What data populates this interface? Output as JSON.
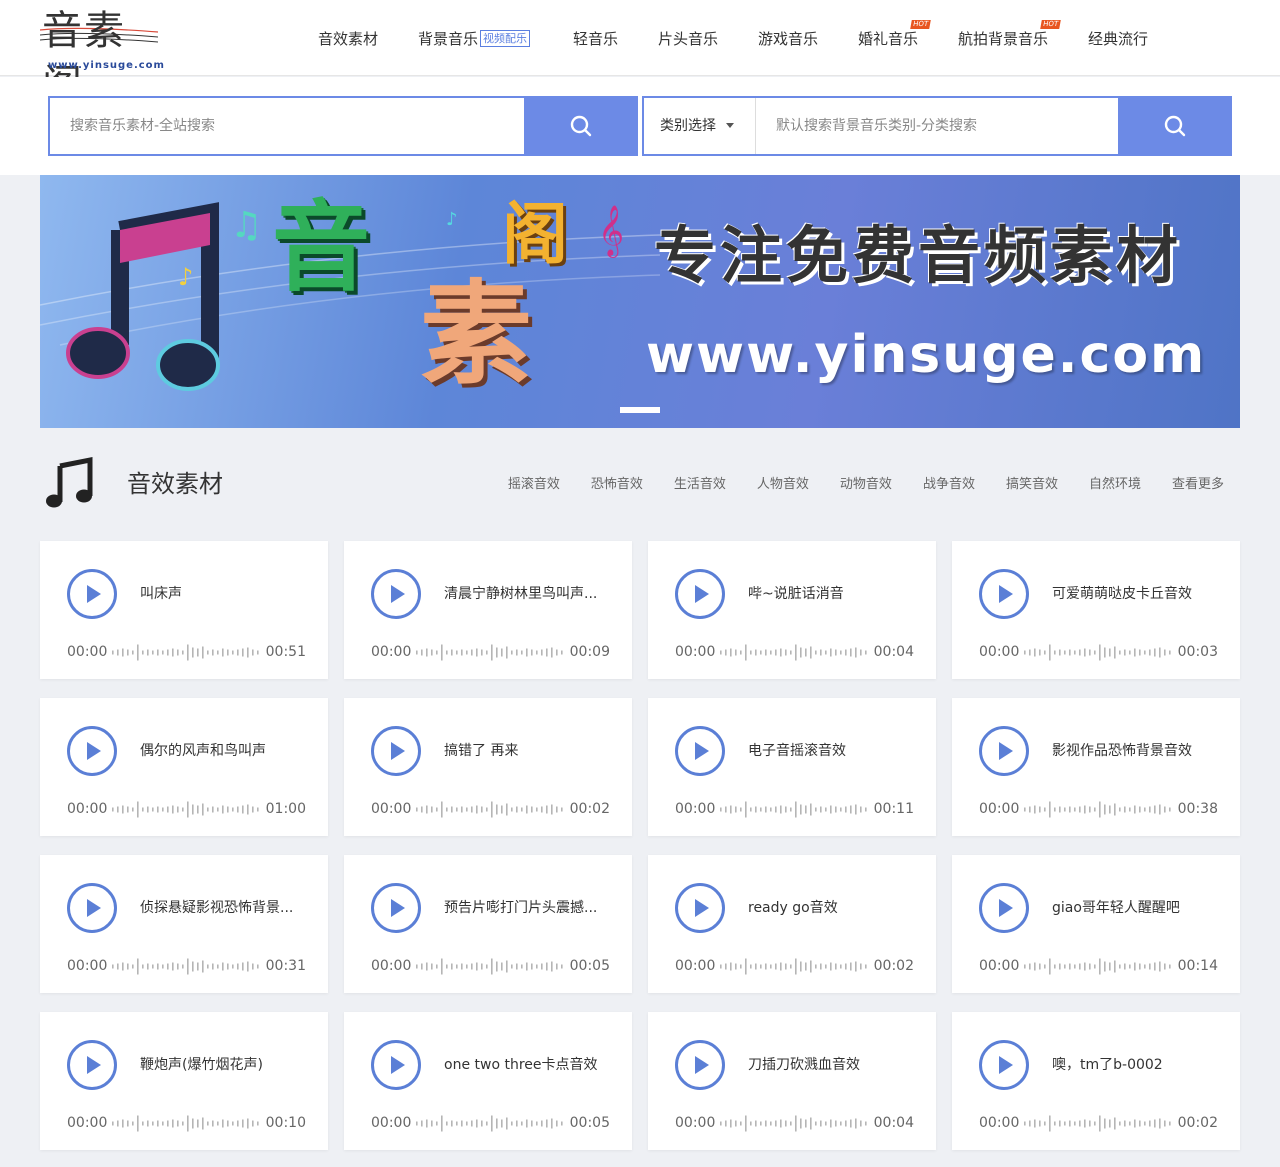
{
  "logo": {
    "text": "音素阁",
    "url": "www.yinsuge.com"
  },
  "nav": {
    "items": [
      {
        "label": "音效素材",
        "tag": "",
        "hot": ""
      },
      {
        "label": "背景音乐",
        "tag": "视频配乐",
        "hot": ""
      },
      {
        "label": "轻音乐",
        "tag": "",
        "hot": ""
      },
      {
        "label": "片头音乐",
        "tag": "",
        "hot": ""
      },
      {
        "label": "游戏音乐",
        "tag": "",
        "hot": ""
      },
      {
        "label": "婚礼音乐",
        "tag": "",
        "hot": "HOT"
      },
      {
        "label": "航拍背景音乐",
        "tag": "",
        "hot": "HOT"
      },
      {
        "label": "经典流行",
        "tag": "",
        "hot": ""
      }
    ]
  },
  "search": {
    "global_placeholder": "搜索音乐素材-全站搜索",
    "category_label": "类别选择",
    "category_placeholder": "默认搜索背景音乐类别-分类搜索"
  },
  "banner": {
    "slogan": "专注免费音频素材",
    "url": "www.yinsuge.com",
    "logo_chars": [
      "音",
      "素",
      "阁"
    ]
  },
  "section": {
    "title": "音效素材",
    "links": [
      "摇滚音效",
      "恐怖音效",
      "生活音效",
      "人物音效",
      "动物音效",
      "战争音效",
      "搞笑音效",
      "自然环境",
      "查看更多"
    ]
  },
  "cards": [
    {
      "title": "叫床声",
      "start": "00:00",
      "duration": "00:51"
    },
    {
      "title": "清晨宁静树林里鸟叫声...",
      "start": "00:00",
      "duration": "00:09"
    },
    {
      "title": "哔~说脏话消音",
      "start": "00:00",
      "duration": "00:04"
    },
    {
      "title": "可爱萌萌哒皮卡丘音效",
      "start": "00:00",
      "duration": "00:03"
    },
    {
      "title": "偶尔的风声和鸟叫声",
      "start": "00:00",
      "duration": "01:00"
    },
    {
      "title": "搞错了 再来",
      "start": "00:00",
      "duration": "00:02"
    },
    {
      "title": "电子音摇滚音效",
      "start": "00:00",
      "duration": "00:11"
    },
    {
      "title": "影视作品恐怖背景音效",
      "start": "00:00",
      "duration": "00:38"
    },
    {
      "title": "侦探悬疑影视恐怖背景...",
      "start": "00:00",
      "duration": "00:31"
    },
    {
      "title": "预告片嘭打门片头震撼...",
      "start": "00:00",
      "duration": "00:05"
    },
    {
      "title": "ready go音效",
      "start": "00:00",
      "duration": "00:02"
    },
    {
      "title": "giao哥年轻人醒醒吧",
      "start": "00:00",
      "duration": "00:14"
    },
    {
      "title": "鞭炮声(爆竹烟花声)",
      "start": "00:00",
      "duration": "00:10"
    },
    {
      "title": "one two three卡点音效",
      "start": "00:00",
      "duration": "00:05"
    },
    {
      "title": "刀插刀砍溅血音效",
      "start": "00:00",
      "duration": "00:04"
    },
    {
      "title": "噢，tm了b-0002",
      "start": "00:00",
      "duration": "00:02"
    }
  ],
  "colors": {
    "accent": "#6c8ae6",
    "play": "#5b7fd6",
    "hot": "#e8551f",
    "page_bg": "#eef0f4"
  }
}
